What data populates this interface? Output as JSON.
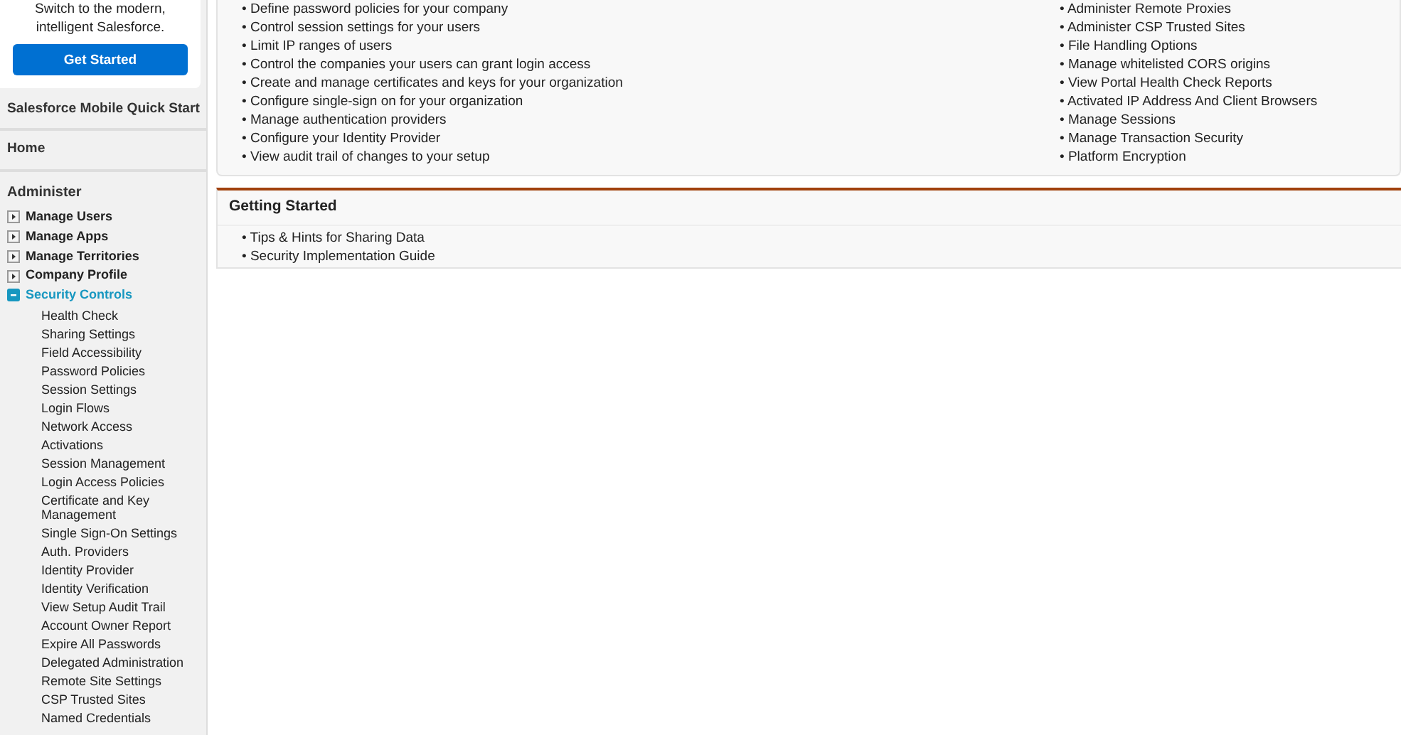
{
  "sidebar": {
    "promo": {
      "text": "Switch to the modern, intelligent Salesforce.",
      "button": "Get Started"
    },
    "links": [
      "Salesforce Mobile Quick Start",
      "Home"
    ],
    "section_title": "Administer",
    "items": [
      {
        "label": "Manage Users",
        "expanded": false,
        "selected": false
      },
      {
        "label": "Manage Apps",
        "expanded": false,
        "selected": false
      },
      {
        "label": "Manage Territories",
        "expanded": false,
        "selected": false
      },
      {
        "label": "Company Profile",
        "expanded": false,
        "selected": false
      },
      {
        "label": "Security Controls",
        "expanded": true,
        "selected": true,
        "children": [
          {
            "label": "Health Check"
          },
          {
            "label": "Sharing Settings"
          },
          {
            "label": "Field Accessibility"
          },
          {
            "label": "Password Policies"
          },
          {
            "label": "Session Settings"
          },
          {
            "label": "Login Flows"
          },
          {
            "label": "Network Access"
          },
          {
            "label": "Activations"
          },
          {
            "label": "Session Management"
          },
          {
            "label": "Login Access Policies"
          },
          {
            "label": "Certificate and Key Management"
          },
          {
            "label": "Single Sign-On Settings"
          },
          {
            "label": "Auth. Providers"
          },
          {
            "label": "Identity Provider"
          },
          {
            "label": "Identity Verification"
          },
          {
            "label": "View Setup Audit Trail"
          },
          {
            "label": "Account Owner Report"
          },
          {
            "label": "Expire All Passwords"
          },
          {
            "label": "Delegated Administration"
          },
          {
            "label": "Remote Site Settings"
          },
          {
            "label": "CSP Trusted Sites"
          },
          {
            "label": "Named Credentials"
          }
        ]
      }
    ]
  },
  "main": {
    "overview": {
      "column_1": [
        "• Define password policies for your company",
        "• Control session settings for your users",
        "• Limit IP ranges of users",
        "• Control the companies your users can grant login access",
        "• Create and manage certificates and keys for your organization",
        "• Configure single-sign on for your organization",
        "• Manage authentication providers",
        "• Configure your Identity Provider",
        "• View audit trail of changes to your setup"
      ],
      "column_2": [
        "• Administer Remote Proxies",
        "• Administer CSP Trusted Sites",
        "• File Handling Options",
        "• Manage whitelisted CORS origins",
        "• View Portal Health Check Reports",
        "• Activated IP Address And Client Browsers",
        "• Manage Sessions",
        "• Manage Transaction Security",
        "• Platform Encryption"
      ]
    },
    "getting_started": {
      "title": "Getting Started",
      "items": [
        "• Tips & Hints for Sharing Data",
        "• Security Implementation Guide"
      ]
    }
  }
}
